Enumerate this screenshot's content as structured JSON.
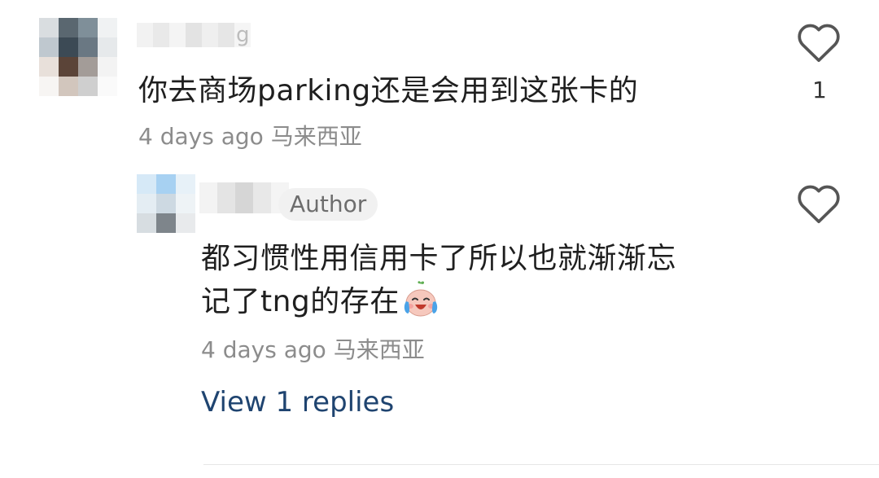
{
  "comments": [
    {
      "username_visible_tail": "g",
      "text": "你去商场parking还是会用到这张卡的",
      "time": "4 days ago",
      "location": "马来西亚",
      "like_count": "1"
    },
    {
      "badge": "Author",
      "text_line1": "都习惯性用信用卡了所以也就渐渐忘",
      "text_line2": "记了tng的存在",
      "emoji_icon": "crying-laughing-face-icon",
      "time": "4 days ago",
      "location": "马来西亚",
      "view_replies": "View 1 replies"
    }
  ],
  "colors": {
    "link": "#1f4470",
    "meta": "#8c8c8c",
    "text": "#1f1f1f"
  }
}
